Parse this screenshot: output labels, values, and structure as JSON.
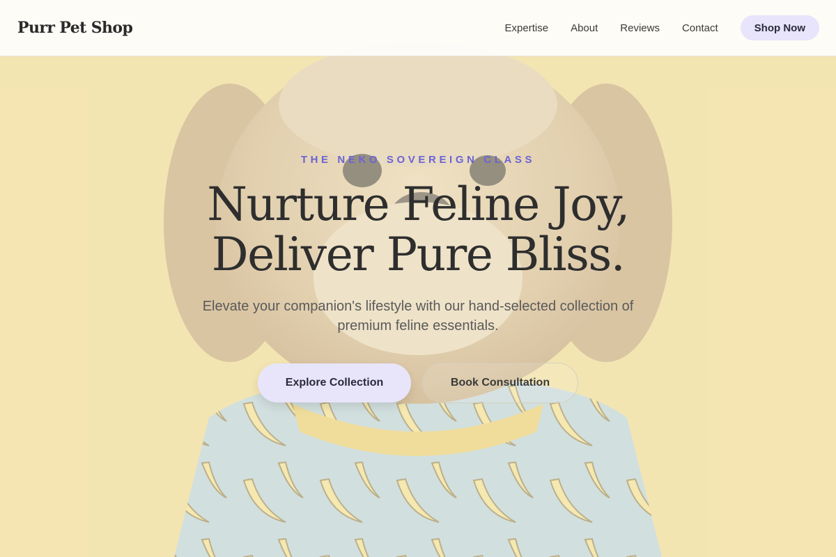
{
  "header": {
    "logo": "Purr Pet Shop",
    "nav": [
      "Expertise",
      "About",
      "Reviews",
      "Contact"
    ],
    "cta": "Shop Now"
  },
  "hero": {
    "eyebrow": "THE NEKO SOVEREIGN CLASS",
    "headline_line1": "Nurture Feline Joy,",
    "headline_line2": "Deliver Pure Bliss.",
    "subtitle": "Elevate your companion's lifestyle with our hand-selected collection of premium feline essentials.",
    "primary_cta": "Explore Collection",
    "secondary_cta": "Book Consultation",
    "background_image": "dog-in-banana-print-shirt-photo"
  },
  "colors": {
    "accent": "#6b63d6",
    "button_bg": "#e7e4fb",
    "background": "#efe0b4",
    "text": "#2e2e2e"
  }
}
